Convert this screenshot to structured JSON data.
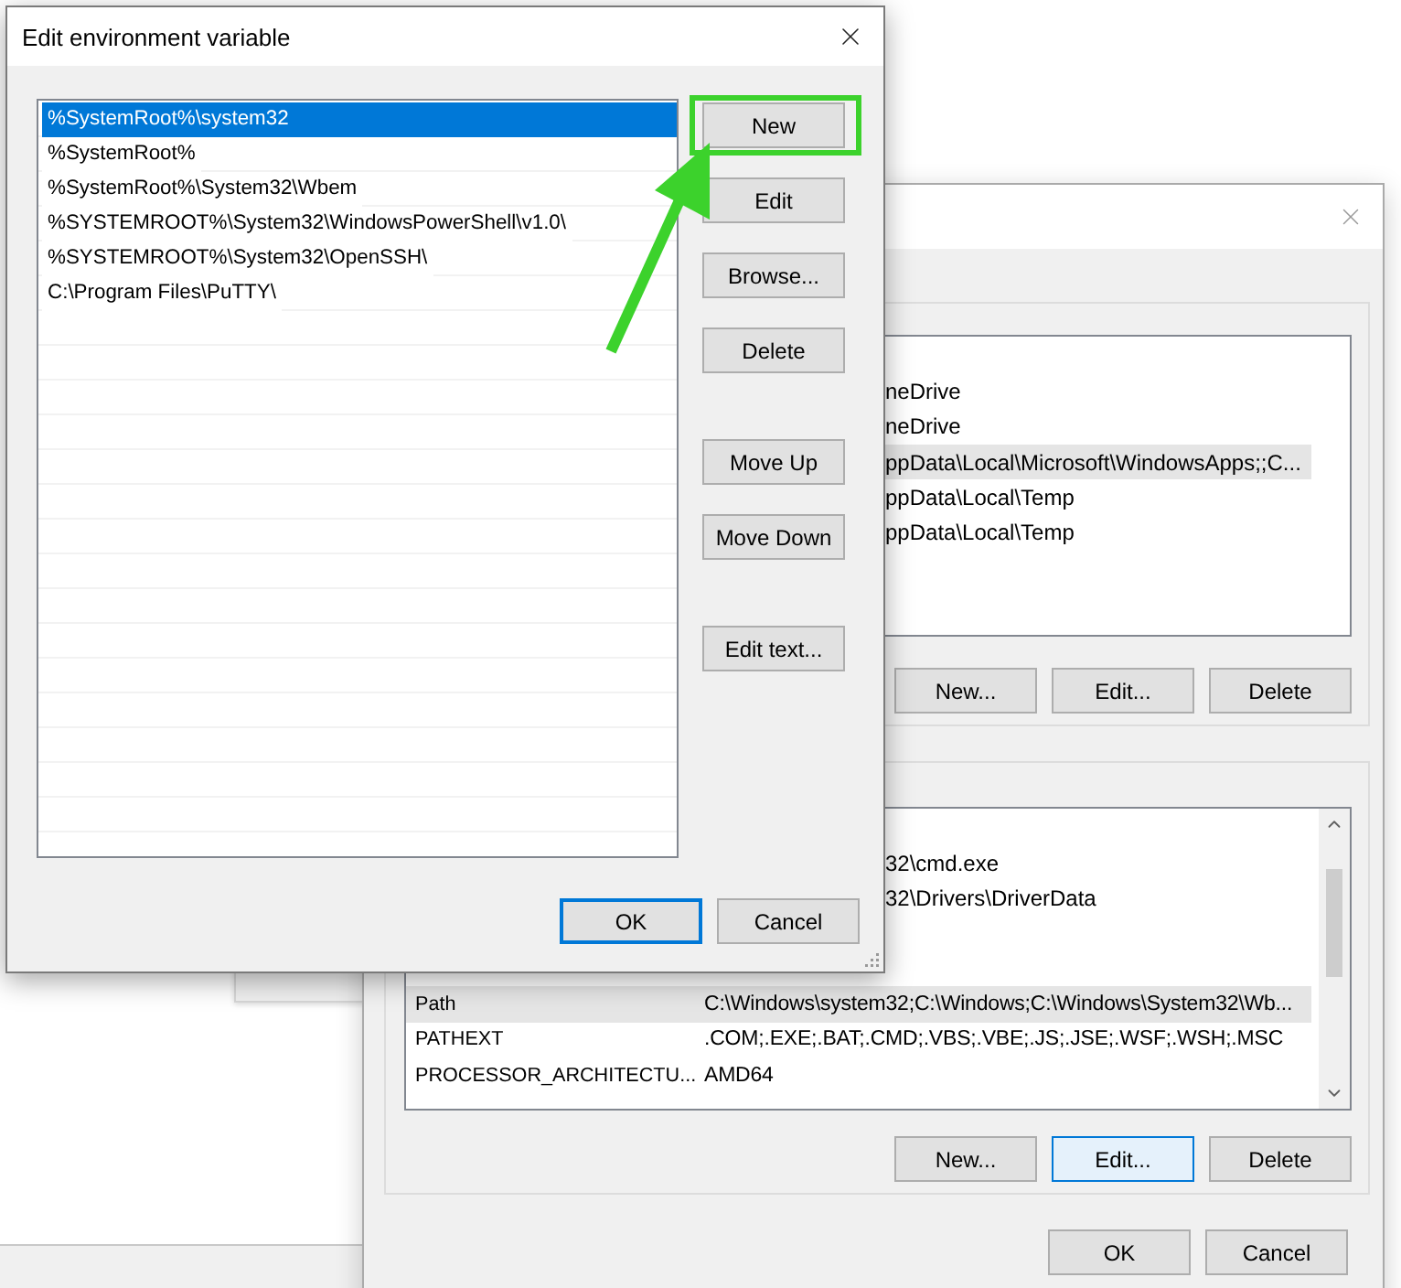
{
  "edit_dialog": {
    "title": "Edit environment variable",
    "entries": [
      {
        "text": "%SystemRoot%\\system32",
        "selected": true
      },
      {
        "text": "%SystemRoot%",
        "selected": false
      },
      {
        "text": "%SystemRoot%\\System32\\Wbem",
        "selected": false
      },
      {
        "text": "%SYSTEMROOT%\\System32\\WindowsPowerShell\\v1.0\\",
        "selected": false
      },
      {
        "text": "%SYSTEMROOT%\\System32\\OpenSSH\\",
        "selected": false
      },
      {
        "text": "C:\\Program Files\\PuTTY\\",
        "selected": false
      }
    ],
    "side_buttons": [
      {
        "label": "New",
        "highlighted": true
      },
      {
        "label": "Edit",
        "highlighted": false
      },
      {
        "label": "Browse...",
        "highlighted": false
      },
      {
        "label": "Delete",
        "highlighted": false
      },
      {
        "label": "Move Up",
        "highlighted": false
      },
      {
        "label": "Move Down",
        "highlighted": false
      },
      {
        "label": "Edit text...",
        "highlighted": false
      }
    ],
    "footer_buttons": [
      {
        "label": "OK",
        "focused": true
      },
      {
        "label": "Cancel",
        "focused": false
      }
    ]
  },
  "env_window": {
    "user_variables": {
      "rows": [
        {
          "value": "neDrive",
          "selected": false
        },
        {
          "value": "neDrive",
          "selected": false
        },
        {
          "value": "ppData\\Local\\Microsoft\\WindowsApps;;C...",
          "selected": true
        },
        {
          "value": "ppData\\Local\\Temp",
          "selected": false
        },
        {
          "value": "ppData\\Local\\Temp",
          "selected": false
        }
      ],
      "buttons": [
        {
          "label": "New...",
          "focused": false
        },
        {
          "label": "Edit...",
          "focused": false
        },
        {
          "label": "Delete",
          "focused": false
        }
      ]
    },
    "system_variables": {
      "upper_rows": [
        {
          "value": "32\\cmd.exe"
        },
        {
          "value": "32\\Drivers\\DriverData"
        }
      ],
      "rows": [
        {
          "variable": "Path",
          "value": "C:\\Windows\\system32;C:\\Windows;C:\\Windows\\System32\\Wb...",
          "selected": true
        },
        {
          "variable": "PATHEXT",
          "value": ".COM;.EXE;.BAT;.CMD;.VBS;.VBE;.JS;.JSE;.WSF;.WSH;.MSC",
          "selected": false
        },
        {
          "variable": "PROCESSOR_ARCHITECTU...",
          "value": "AMD64",
          "selected": false
        }
      ],
      "buttons": [
        {
          "label": "New...",
          "focused": false
        },
        {
          "label": "Edit...",
          "focused": true
        },
        {
          "label": "Delete",
          "focused": false
        }
      ]
    },
    "footer_buttons": [
      {
        "label": "OK"
      },
      {
        "label": "Cancel"
      }
    ]
  }
}
